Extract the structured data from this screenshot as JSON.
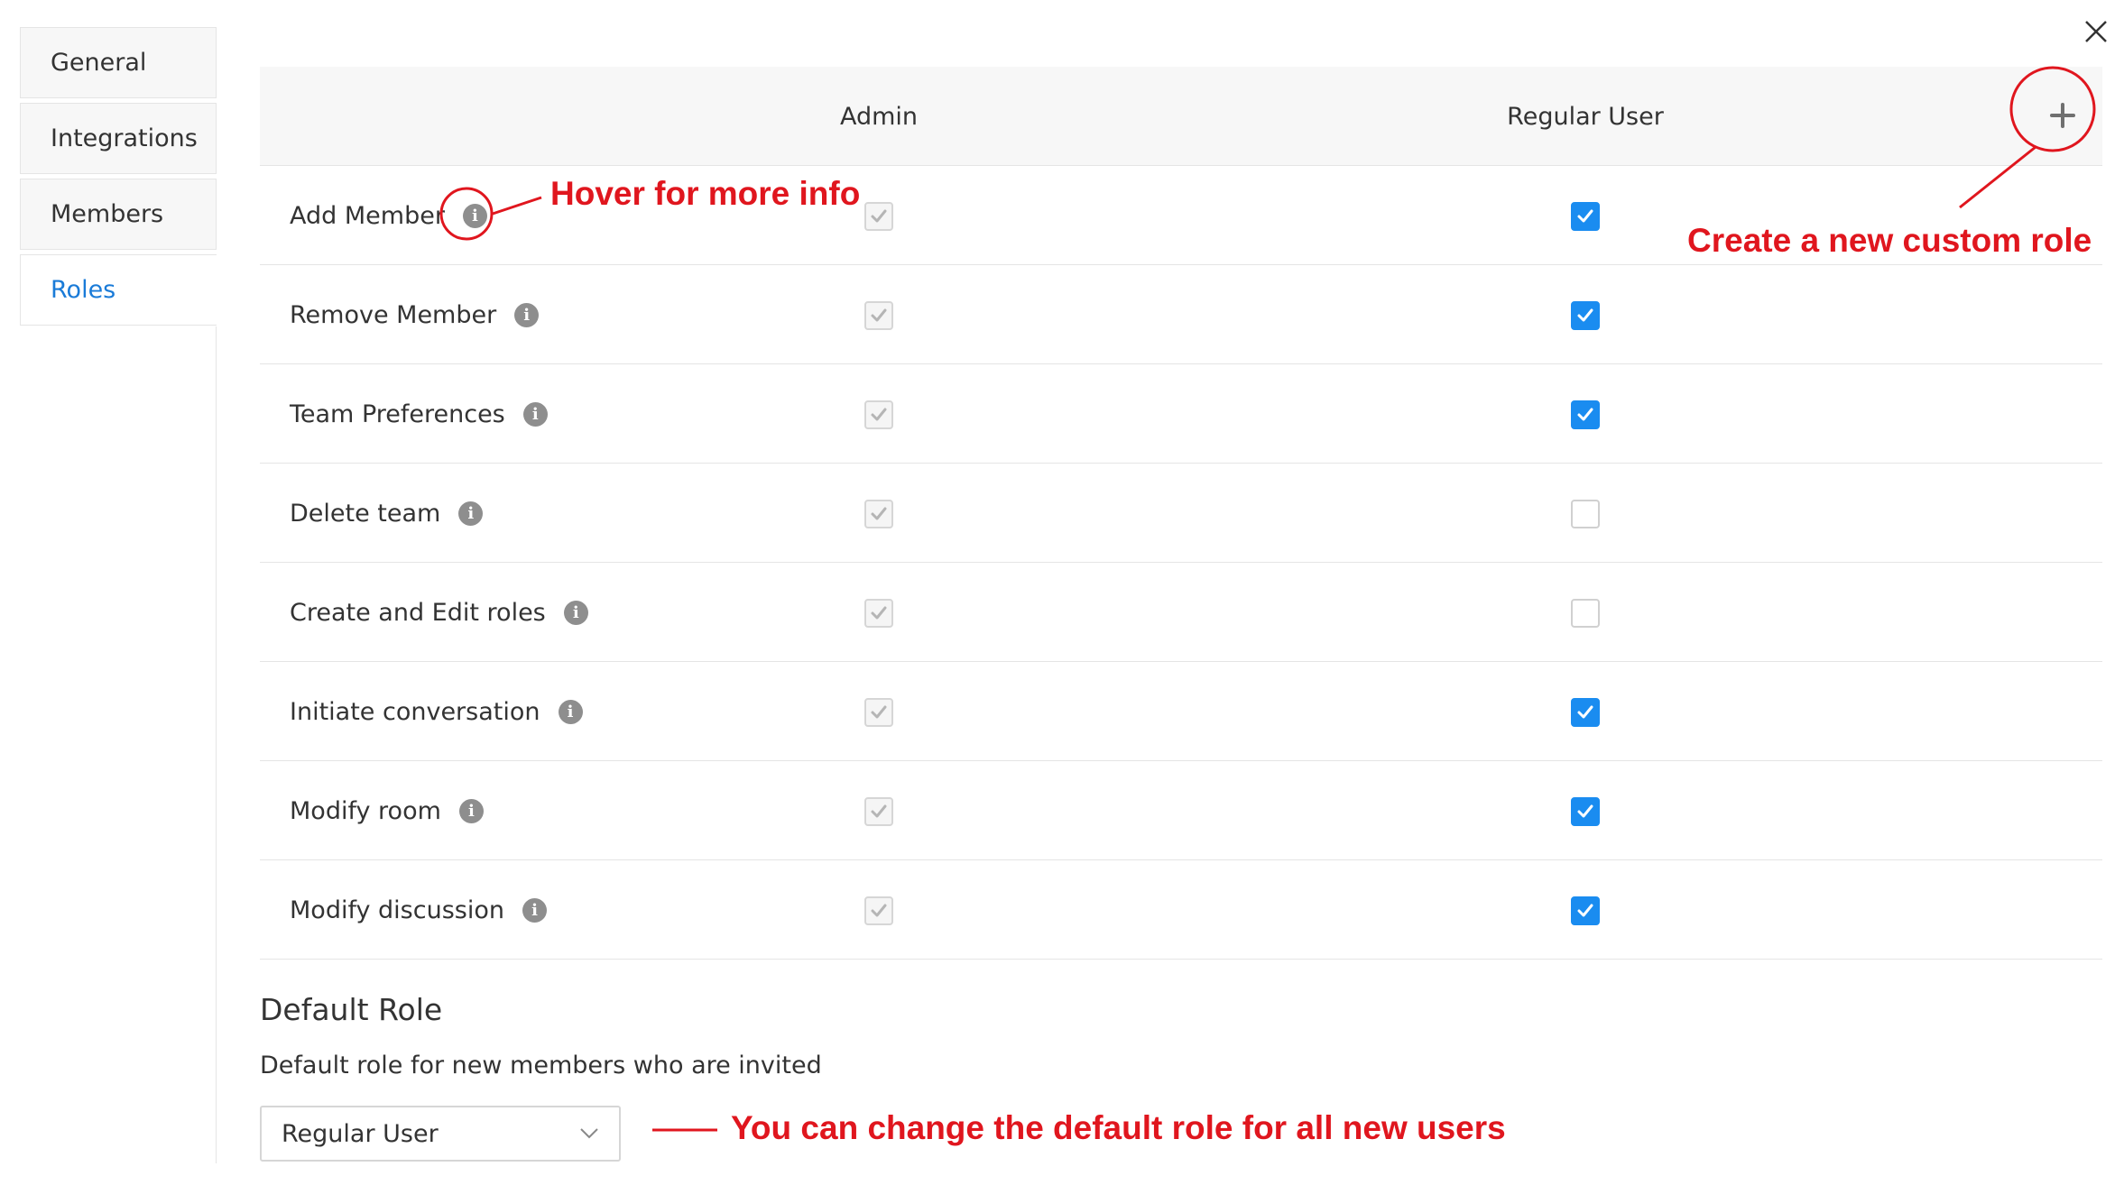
{
  "sidebar": {
    "items": [
      {
        "label": "General"
      },
      {
        "label": "Integrations"
      },
      {
        "label": "Members"
      },
      {
        "label": "Roles",
        "active": true
      }
    ]
  },
  "table": {
    "columns": [
      "Admin",
      "Regular User"
    ],
    "add_role_icon": "plus-icon",
    "rows": [
      {
        "label": "Add Member",
        "admin": "checked-disabled",
        "regular_user": "checked"
      },
      {
        "label": "Remove Member",
        "admin": "checked-disabled",
        "regular_user": "checked"
      },
      {
        "label": "Team Preferences",
        "admin": "checked-disabled",
        "regular_user": "checked"
      },
      {
        "label": "Delete team",
        "admin": "checked-disabled",
        "regular_user": "unchecked"
      },
      {
        "label": "Create and Edit roles",
        "admin": "checked-disabled",
        "regular_user": "unchecked"
      },
      {
        "label": "Initiate conversation",
        "admin": "checked-disabled",
        "regular_user": "checked"
      },
      {
        "label": "Modify room",
        "admin": "checked-disabled",
        "regular_user": "checked"
      },
      {
        "label": "Modify discussion",
        "admin": "checked-disabled",
        "regular_user": "checked"
      }
    ]
  },
  "default_role": {
    "title": "Default Role",
    "description": "Default role for new members who are invited",
    "selected": "Regular User"
  },
  "annotations": {
    "hover": "Hover for more info",
    "create": "Create a new custom role",
    "change_default": "You can change the default role for all new users"
  },
  "colors": {
    "accent": "#1a8cf0",
    "active_link": "#1a7bd8",
    "annotation": "#e0161e"
  }
}
